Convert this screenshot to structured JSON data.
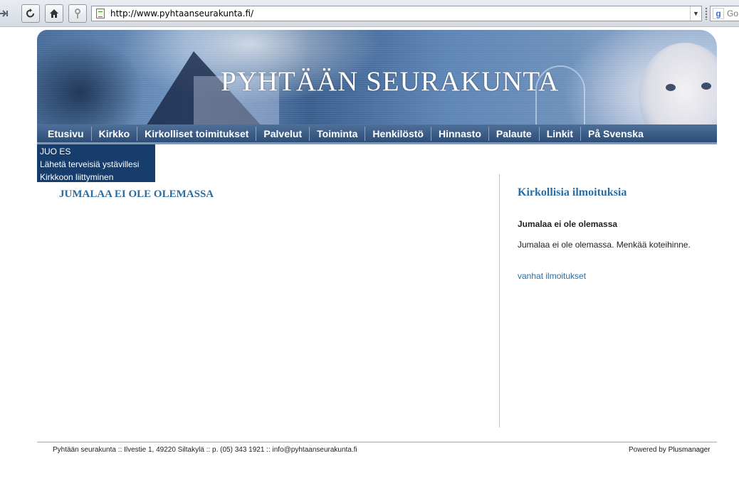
{
  "browser": {
    "url": "http://www.pyhtaanseurakunta.fi/",
    "search_text": "Go"
  },
  "banner": {
    "title": "PYHTÄÄN SEURAKUNTA"
  },
  "nav": {
    "items": [
      {
        "label": "Etusivu"
      },
      {
        "label": "Kirkko"
      },
      {
        "label": "Kirkolliset toimitukset"
      },
      {
        "label": "Palvelut"
      },
      {
        "label": "Toiminta"
      },
      {
        "label": "Henkilöstö"
      },
      {
        "label": "Hinnasto"
      },
      {
        "label": "Palaute"
      },
      {
        "label": "Linkit"
      },
      {
        "label": "På Svenska"
      }
    ]
  },
  "submenu": {
    "items": [
      {
        "label": "JUO ES"
      },
      {
        "label": "Lähetä terveisiä ystävillesi"
      },
      {
        "label": "Kirkkoon liittyminen"
      }
    ]
  },
  "main": {
    "title": "JUMALAA EI OLE OLEMASSA"
  },
  "side": {
    "title": "Kirkollisia ilmoituksia",
    "heading": "Jumalaa ei ole olemassa",
    "text": "Jumalaa ei ole olemassa. Menkää koteihinne.",
    "link": "vanhat ilmoitukset"
  },
  "footer": {
    "left": "Pyhtään seurakunta :: Ilvestie 1, 49220 Siltakylä :: p. (05) 343 1921 :: info@pyhtaanseurakunta.fi",
    "powered_by": "Powered by",
    "vendor": "Plusmanager"
  },
  "colors": {
    "nav_bg": "#3b5e88",
    "submenu_bg": "#163d6b",
    "heading_blue": "#2a6da0"
  }
}
